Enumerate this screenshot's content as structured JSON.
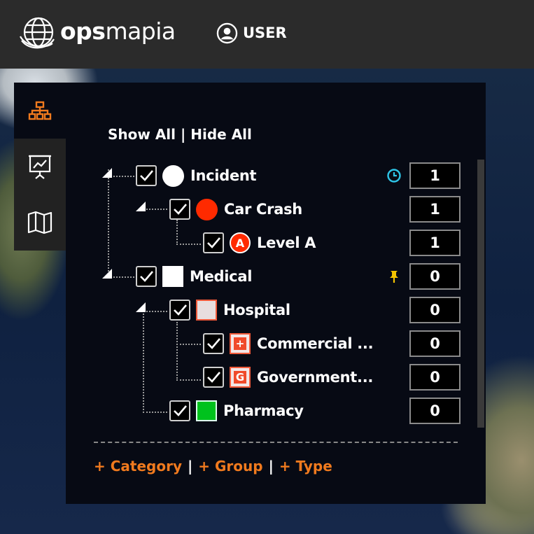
{
  "header": {
    "brand_bold": "ops",
    "brand_rest": "mapia",
    "user_label": "USER",
    "logo_icon": "globe-icon",
    "user_icon": "user-circle-icon"
  },
  "sidebar": {
    "items": [
      {
        "icon": "hierarchy-icon",
        "active": true
      },
      {
        "icon": "presentation-chart-icon",
        "active": false
      },
      {
        "icon": "map-icon",
        "active": false
      }
    ]
  },
  "panel": {
    "show_all": "Show All",
    "separator": "|",
    "hide_all": "Hide All",
    "rows": [
      {
        "label": "Incident",
        "count": "1",
        "symbol": "white-circle",
        "status_icon": "clock-icon"
      },
      {
        "label": "Car Crash",
        "count": "1",
        "symbol": "red-circle"
      },
      {
        "label": "Level A",
        "count": "1",
        "symbol": "red-badge",
        "badge": "A"
      },
      {
        "label": "Medical",
        "count": "0",
        "symbol": "white-square",
        "status_icon": "pin-icon"
      },
      {
        "label": "Hospital",
        "count": "0",
        "symbol": "light-square"
      },
      {
        "label": "Commercial ...",
        "count": "0",
        "symbol": "red-square-badge",
        "badge": "+"
      },
      {
        "label": "Government...",
        "count": "0",
        "symbol": "red-square-badge",
        "badge": "G"
      },
      {
        "label": "Pharmacy",
        "count": "0",
        "symbol": "green-square"
      }
    ],
    "add_category": "+ Category",
    "add_group": "+ Group",
    "add_type": "+ Type"
  },
  "colors": {
    "accent": "#f07a1e",
    "red": "#ff2a00",
    "green": "#00c21d",
    "clock": "#2ec4e6",
    "pin": "#f5c400"
  }
}
